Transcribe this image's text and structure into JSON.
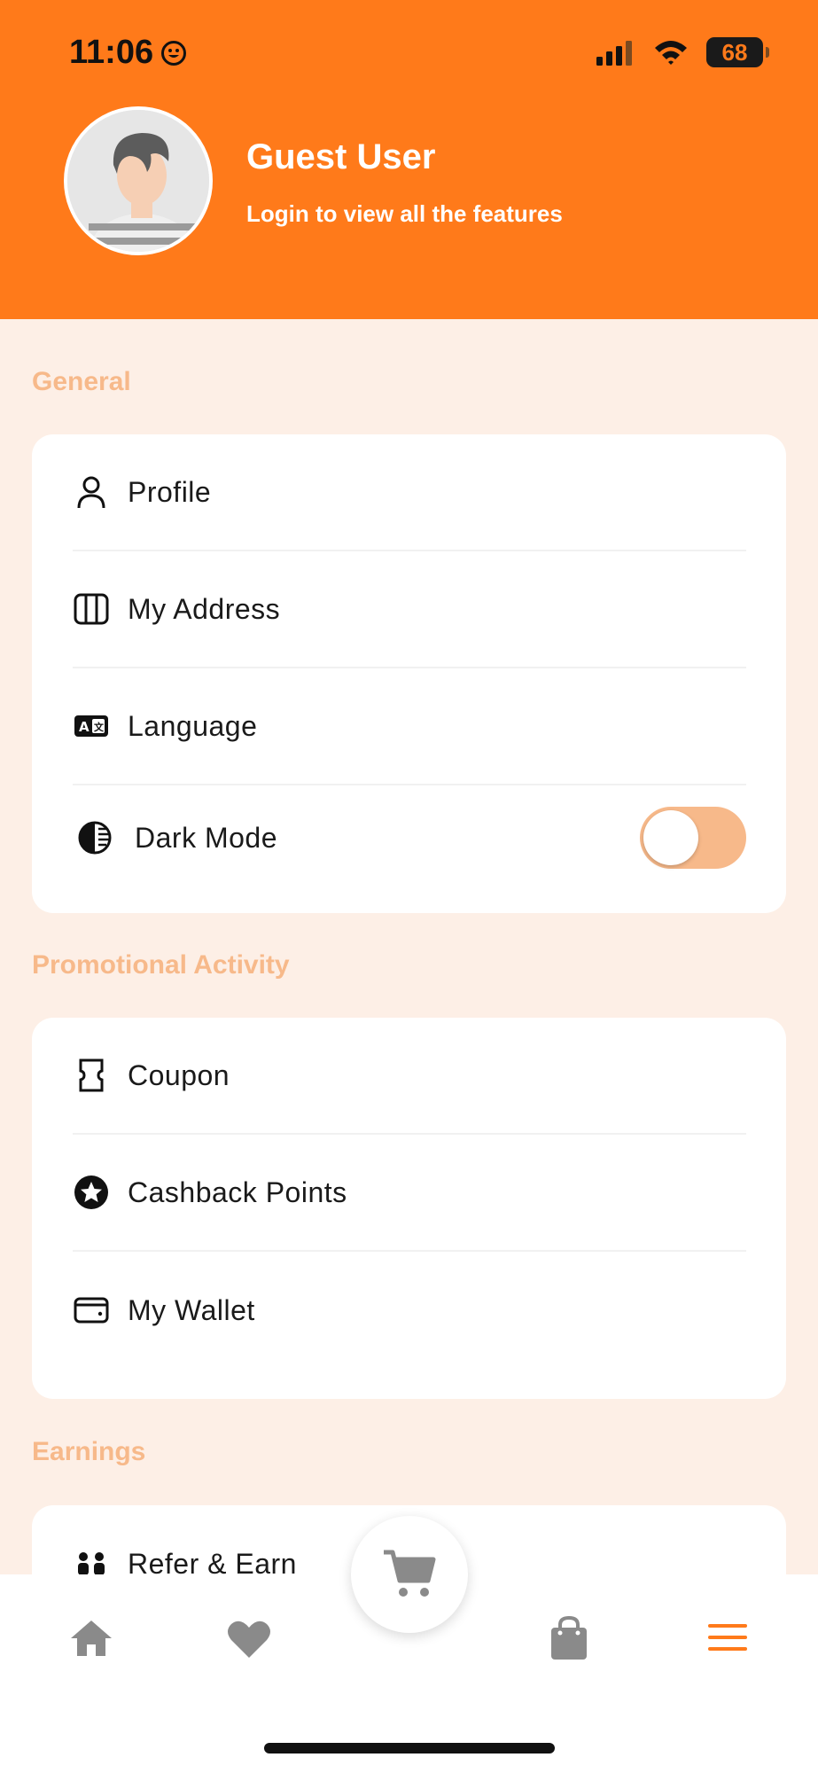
{
  "status_bar": {
    "time": "11:06",
    "battery": "68"
  },
  "header": {
    "name": "Guest User",
    "subtitle": "Login to view all the features"
  },
  "sections": {
    "general": {
      "title": "General",
      "items": [
        {
          "label": "Profile",
          "icon": "person-icon"
        },
        {
          "label": "My Address",
          "icon": "map-icon"
        },
        {
          "label": "Language",
          "icon": "translate-icon"
        },
        {
          "label": "Dark Mode",
          "icon": "contrast-icon",
          "toggle_on": false
        }
      ]
    },
    "promotional": {
      "title": "Promotional Activity",
      "items": [
        {
          "label": "Coupon",
          "icon": "ticket-icon"
        },
        {
          "label": "Cashback Points",
          "icon": "star-badge-icon"
        },
        {
          "label": "My Wallet",
          "icon": "wallet-icon"
        }
      ]
    },
    "earnings": {
      "title": "Earnings",
      "items": [
        {
          "label": "Refer & Earn",
          "icon": "people-icon"
        }
      ]
    }
  },
  "bottom_nav": {
    "items": [
      "home-icon",
      "heart-icon",
      "cart-icon",
      "bag-icon",
      "menu-icon"
    ],
    "active": "menu-icon"
  },
  "colors": {
    "accent": "#ff7a1a",
    "section_title": "#f7b98a",
    "background": "#fdefe6",
    "nav_inactive": "#8a8a8a"
  }
}
